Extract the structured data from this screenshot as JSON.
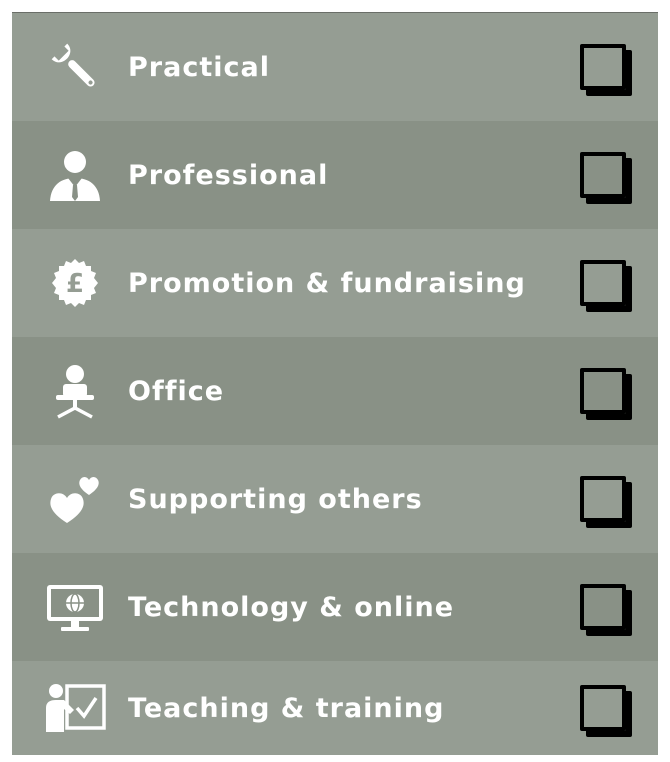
{
  "categories": [
    {
      "label": "Practical",
      "icon": "wrench-icon",
      "checked": false
    },
    {
      "label": "Professional",
      "icon": "professional-person-icon",
      "checked": false
    },
    {
      "label": "Promotion & fundraising",
      "icon": "pound-coin-icon",
      "checked": false
    },
    {
      "label": "Office",
      "icon": "office-chair-icon",
      "checked": false
    },
    {
      "label": "Supporting others",
      "icon": "hearts-icon",
      "checked": false
    },
    {
      "label": "Technology & online",
      "icon": "computer-monitor-icon",
      "checked": false
    },
    {
      "label": "Teaching & training",
      "icon": "teacher-whiteboard-icon",
      "checked": false
    }
  ],
  "colors": {
    "row_light": "#959d93",
    "row_dark": "#899186",
    "text": "#ffffff",
    "checkbox": "#000000"
  }
}
